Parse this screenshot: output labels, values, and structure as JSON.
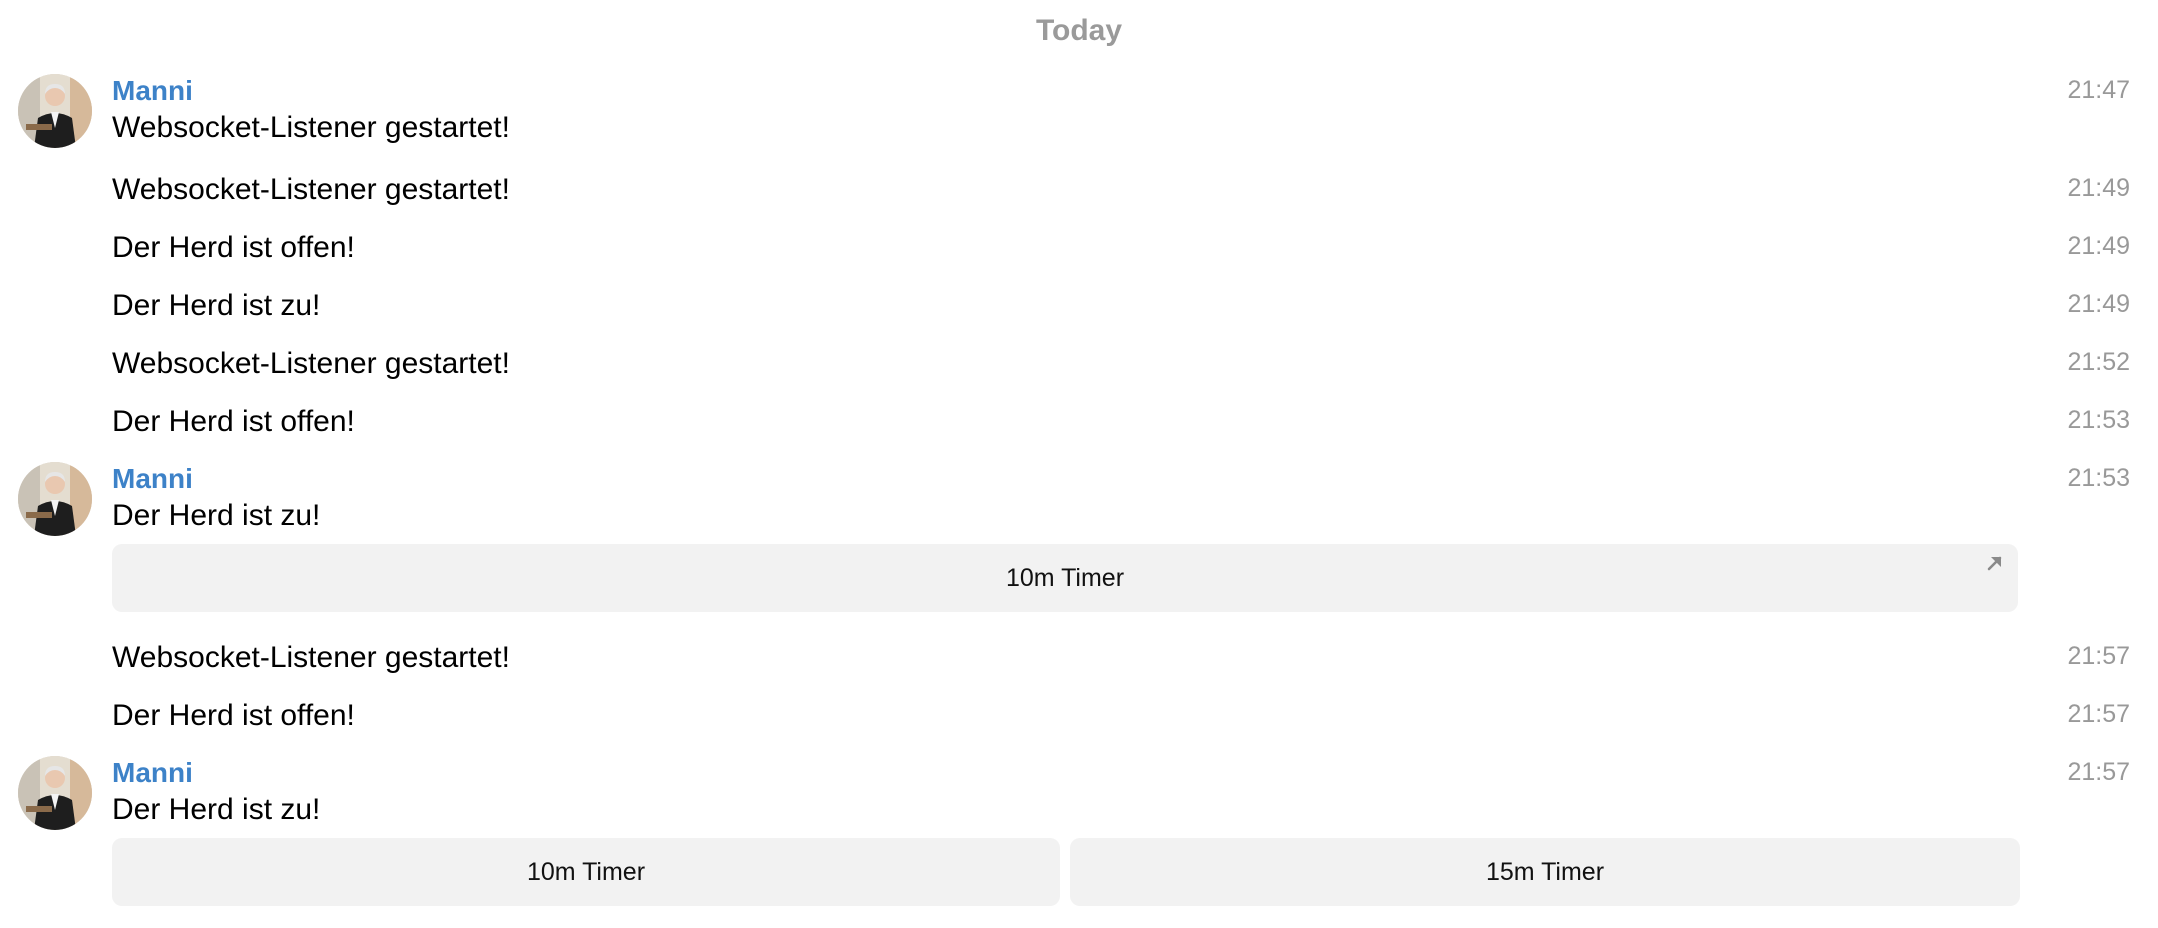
{
  "date_separator": "Today",
  "groups": [
    {
      "sender": "Manni",
      "messages": [
        {
          "text": "Websocket-Listener gestartet!",
          "time": "21:47"
        },
        {
          "text": "Websocket-Listener gestartet!",
          "time": "21:49"
        },
        {
          "text": "Der Herd ist offen!",
          "time": "21:49"
        },
        {
          "text": "Der Herd ist zu!",
          "time": "21:49"
        },
        {
          "text": "Websocket-Listener gestartet!",
          "time": "21:52"
        },
        {
          "text": "Der Herd ist offen!",
          "time": "21:53"
        }
      ]
    },
    {
      "sender": "Manni",
      "messages": [
        {
          "text": "Der Herd ist zu!",
          "time": "21:53"
        }
      ],
      "inline_buttons": [
        {
          "label": "10m Timer",
          "icon": "arrow-up-left-icon"
        }
      ]
    },
    {
      "sender": "",
      "messages": [
        {
          "text": "Websocket-Listener gestartet!",
          "time": "21:57"
        },
        {
          "text": "Der Herd ist offen!",
          "time": "21:57"
        }
      ]
    },
    {
      "sender": "Manni",
      "messages": [
        {
          "text": "Der Herd ist zu!",
          "time": "21:57"
        }
      ],
      "inline_buttons": [
        {
          "label": "10m Timer"
        },
        {
          "label": "15m Timer"
        }
      ]
    }
  ],
  "colors": {
    "sender_name": "#3d82c8",
    "timestamp": "#999999",
    "date_separator": "#9a9a9a",
    "button_bg": "#f2f2f2"
  }
}
